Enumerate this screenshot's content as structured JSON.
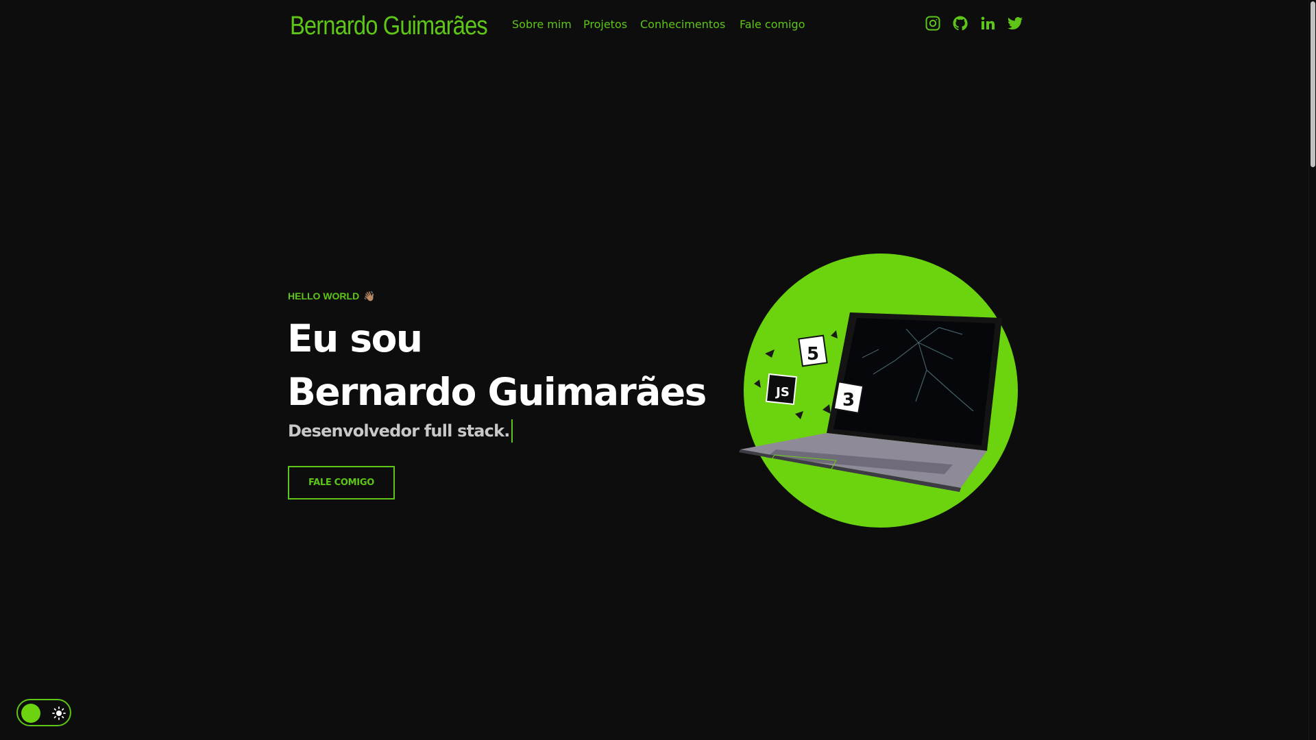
{
  "header": {
    "brand": "Bernardo Guimarães",
    "nav": [
      {
        "label": "Sobre mim"
      },
      {
        "label": "Projetos"
      },
      {
        "label": "Conhecimentos"
      },
      {
        "label": "Fale comigo"
      }
    ],
    "social": [
      "instagram-icon",
      "github-icon",
      "linkedin-icon",
      "twitter-icon"
    ]
  },
  "hero": {
    "eyebrow": "HELLO WORLD",
    "eyebrow_emoji": "👋🏽",
    "heading_line1": "Eu sou",
    "heading_line2": "Bernardo Guimarães",
    "subtitle": "Desenvolvedor full stack.",
    "cta_label": "FALE COMIGO",
    "illustration_badges": [
      "5",
      "JS",
      "3"
    ]
  },
  "theme_toggle": {
    "icon": "sun-icon"
  },
  "colors": {
    "background": "#0d0d0d",
    "accent": "#5ec617",
    "accent_bright": "#6cd40e",
    "heading": "#ffffff",
    "subtitle": "#c8c8c8"
  }
}
